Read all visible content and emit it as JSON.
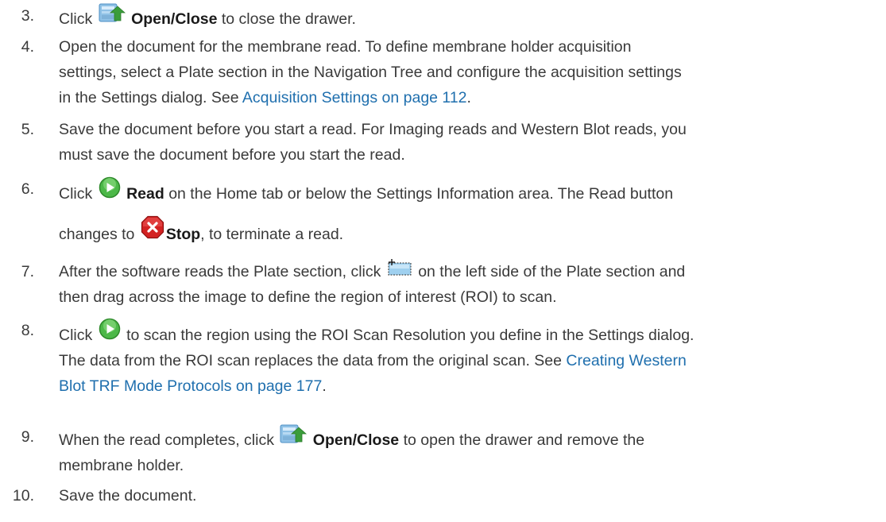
{
  "steps": [
    {
      "num": "3.",
      "t1": "Click",
      "b1": "Open/Close",
      "t2": "to close the drawer.",
      "icon": "open-close-icon"
    },
    {
      "num": "4.",
      "lines": [
        "Open the document for the membrane read. To define membrane holder acquisition",
        "settings, select a Plate section in the Navigation Tree and configure the acquisition settings",
        "in the Settings dialog. See"
      ],
      "link": "Acquisition Settings on page 112",
      "after": "."
    },
    {
      "num": "5.",
      "lines": [
        "Save the document before you start a read. For Imaging reads and Western Blot reads, you",
        "must save the document before you start the read."
      ]
    },
    {
      "num": "6.",
      "t1": "Click",
      "b1": "Read",
      "t2": "on the Home tab or below the Settings Information area. The Read button",
      "t3": "changes to",
      "b2": "Stop",
      "t4": ", to terminate a read.",
      "icon1": "play-icon",
      "icon2": "stop-icon"
    },
    {
      "num": "7.",
      "t1": "After the software reads the Plate section, click",
      "t2": "on the left side of the Plate section and",
      "t3": "then drag across the image to define the region of interest (ROI) to scan.",
      "icon": "roi-select-icon"
    },
    {
      "num": "8.",
      "t1": "Click",
      "t2": "to scan the region using the ROI Scan Resolution you define in the Settings dialog.",
      "t3": "The data from the ROI scan replaces the data from the original scan. See",
      "link1": "Creating Western",
      "link2": "Blot TRF Mode Protocols on page 177",
      "after": ".",
      "icon": "play-icon"
    },
    {
      "num": "9.",
      "t1": "When the read completes, click",
      "b1": "Open/Close",
      "t2": "to open the drawer and remove the",
      "t3": "membrane holder.",
      "icon": "open-close-icon"
    },
    {
      "num": "10.",
      "t1": "Save the document."
    }
  ]
}
